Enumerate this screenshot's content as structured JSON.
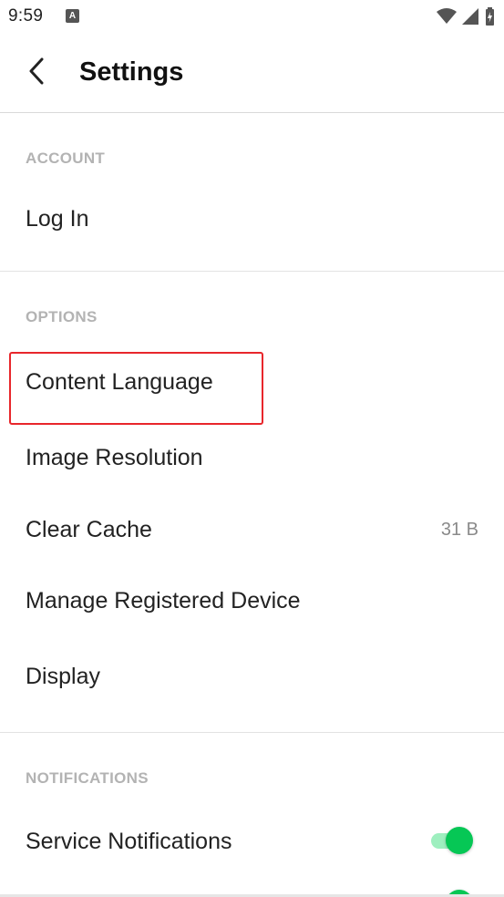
{
  "status_bar": {
    "time": "9:59",
    "notification_icon": "A",
    "icons": [
      "wifi-icon",
      "cell-signal-icon",
      "battery-charging-icon"
    ]
  },
  "header": {
    "title": "Settings",
    "back_icon": "chevron-left-icon"
  },
  "sections": {
    "account": {
      "header": "ACCOUNT",
      "items": [
        {
          "label": "Log In"
        }
      ]
    },
    "options": {
      "header": "OPTIONS",
      "items": [
        {
          "label": "Content Language"
        },
        {
          "label": "Image Resolution"
        },
        {
          "label": "Clear Cache",
          "value": "31 B"
        },
        {
          "label": "Manage Registered Device"
        },
        {
          "label": "Display"
        }
      ]
    },
    "notifications": {
      "header": "NOTIFICATIONS",
      "items": [
        {
          "label": "Service Notifications",
          "toggle": true
        }
      ]
    }
  },
  "colors": {
    "accent_green": "#06c755",
    "toggle_track": "#9eefbf",
    "highlight_red": "#e8262b",
    "section_header_gray": "#b3b3b3"
  }
}
